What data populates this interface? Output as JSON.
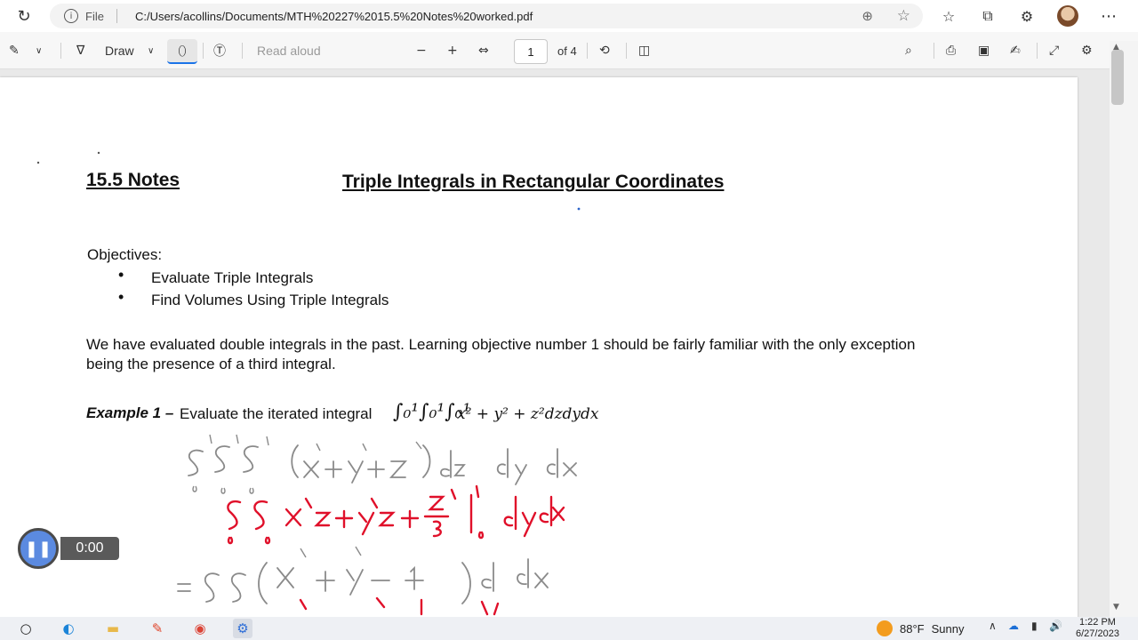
{
  "browser": {
    "file_label": "File",
    "url": "C:/Users/acollins/Documents/MTH%20227%2015.5%20Notes%20worked.pdf",
    "icons": [
      "refresh-icon",
      "info-icon",
      "zoom-icon",
      "star-icon",
      "favorites-icon",
      "collections-icon",
      "extensions-icon",
      "avatar",
      "more-icon"
    ]
  },
  "pdf_toolbar": {
    "draw_label": "Draw",
    "read_aloud_label": "Read aloud",
    "page_number": "1",
    "page_total": "of 4"
  },
  "document": {
    "title_left": "15.5 Notes",
    "title_center": "Triple Integrals in Rectangular Coordinates",
    "objectives_heading": "Objectives:",
    "objectives": [
      "Evaluate Triple Integrals",
      "Find Volumes Using Triple Integrals"
    ],
    "paragraph_line1": "We have evaluated double integrals in the past.  Learning objective number 1 should be fairly familiar with the only exception",
    "paragraph_line2": "being the presence of a third integral.",
    "example_label": "Example 1 –",
    "example_text": "Evaluate the iterated integral",
    "example_expression": "x² + y² + z²dzdydx"
  },
  "player": {
    "time": "0:00"
  },
  "taskbar": {
    "temperature": "88°F",
    "condition": "Sunny",
    "time": "1:22 PM",
    "date": "6/27/2023"
  },
  "colors": {
    "accent": "#1a73e8",
    "handwriting_gray": "#8a8a8a",
    "handwriting_red": "#e0102a"
  }
}
